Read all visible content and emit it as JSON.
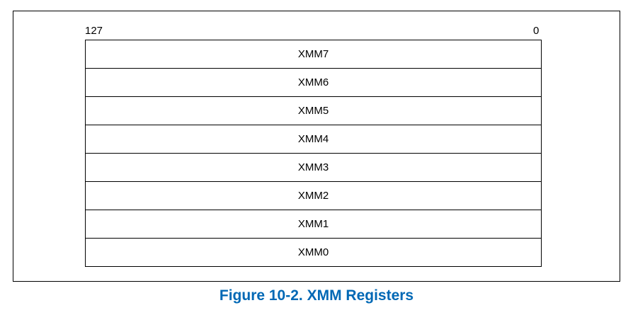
{
  "diagram": {
    "bit_high": "127",
    "bit_low": "0",
    "registers": [
      "XMM7",
      "XMM6",
      "XMM5",
      "XMM4",
      "XMM3",
      "XMM2",
      "XMM1",
      "XMM0"
    ]
  },
  "caption": {
    "text": "Figure 10-2.  XMM Registers"
  },
  "colors": {
    "caption": "#0068b5",
    "line": "#000000"
  }
}
